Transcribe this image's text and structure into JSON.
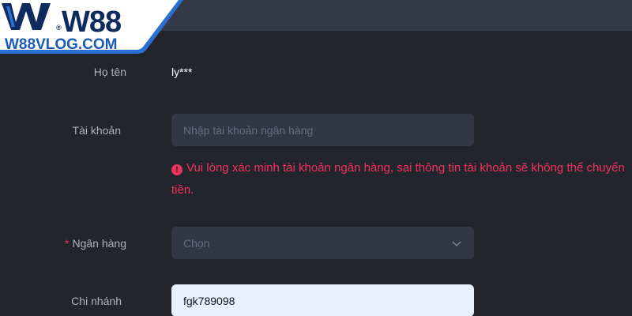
{
  "logo": {
    "brand": "W88",
    "registered": "®",
    "site": "W88VLOG.COM"
  },
  "form": {
    "name_label": "Họ tên",
    "name_value": "ly***",
    "account_label": "Tài khoản",
    "account_placeholder": "Nhập tài khoản ngân hàng",
    "account_error": "Vui lòng xác minh tài khoản ngân hàng, sai thông tin tài khoản sẽ không thể chuyển tiền.",
    "bank_required_mark": "*",
    "bank_label": "Ngân hàng",
    "bank_placeholder": "Chọn",
    "branch_label": "Chi nhánh",
    "branch_value": "fgk789098"
  },
  "colors": {
    "background": "#23252c",
    "topbar": "#363a48",
    "input_bg": "#333745",
    "error": "#f0335e",
    "filled_input_bg": "#e8f0fe"
  },
  "icons": [
    "logo-w-mark",
    "error-info-icon",
    "chevron-down-icon"
  ]
}
